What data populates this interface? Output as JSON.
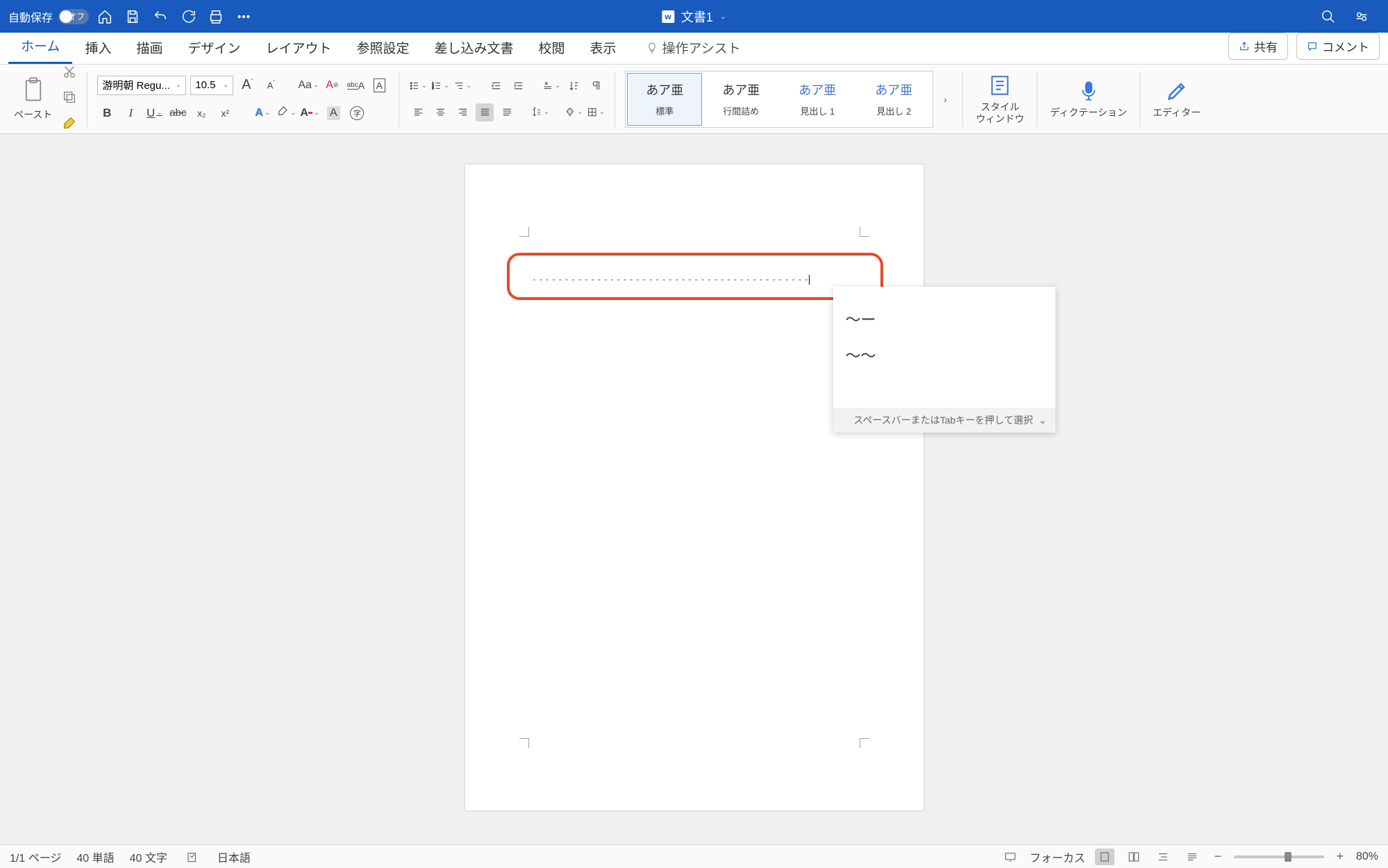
{
  "titlebar": {
    "autosave_label": "自動保存",
    "toggle_state": "オフ",
    "doc_title": "文書1"
  },
  "tabs": {
    "home": "ホーム",
    "insert": "挿入",
    "draw": "描画",
    "design": "デザイン",
    "layout": "レイアウト",
    "references": "参照設定",
    "mailings": "差し込み文書",
    "review": "校閲",
    "view": "表示",
    "assist": "操作アシスト",
    "share": "共有",
    "comment": "コメント"
  },
  "ribbon": {
    "paste": "ペースト",
    "font_name": "游明朝 Regu...",
    "font_size": "10.5",
    "aa": "Aa",
    "bold": "B",
    "italic": "I",
    "underline": "U",
    "strike": "abc",
    "sub": "x₂",
    "sup": "x²",
    "a_effect": "A",
    "a_color": "A",
    "a_highlight": "A",
    "char_circle": "字",
    "styles": [
      {
        "preview": "あア亜",
        "name": "標準",
        "selected": true,
        "blue": false
      },
      {
        "preview": "あア亜",
        "name": "行間詰め",
        "selected": false,
        "blue": false
      },
      {
        "preview": "あア亜",
        "name": "見出し 1",
        "selected": false,
        "blue": true
      },
      {
        "preview": "あア亜",
        "name": "見出し 2",
        "selected": false,
        "blue": true
      }
    ],
    "style_pane": "スタイル\nウィンドウ",
    "dictation": "ディクテーション",
    "editor": "エディター"
  },
  "document": {
    "dash_line": "- - - - - - - - - - - - - - - - - - - - - - - - - - - - - - - - - - - - - - - - - - -"
  },
  "ime": {
    "candidates": [
      "〜ー",
      "〜〜"
    ],
    "footer": "スペースバーまたはTabキーを押して選択"
  },
  "status": {
    "page": "1/1 ページ",
    "words": "40 単語",
    "chars": "40 文字",
    "lang": "日本語",
    "focus": "フォーカス",
    "zoom": "80%"
  }
}
